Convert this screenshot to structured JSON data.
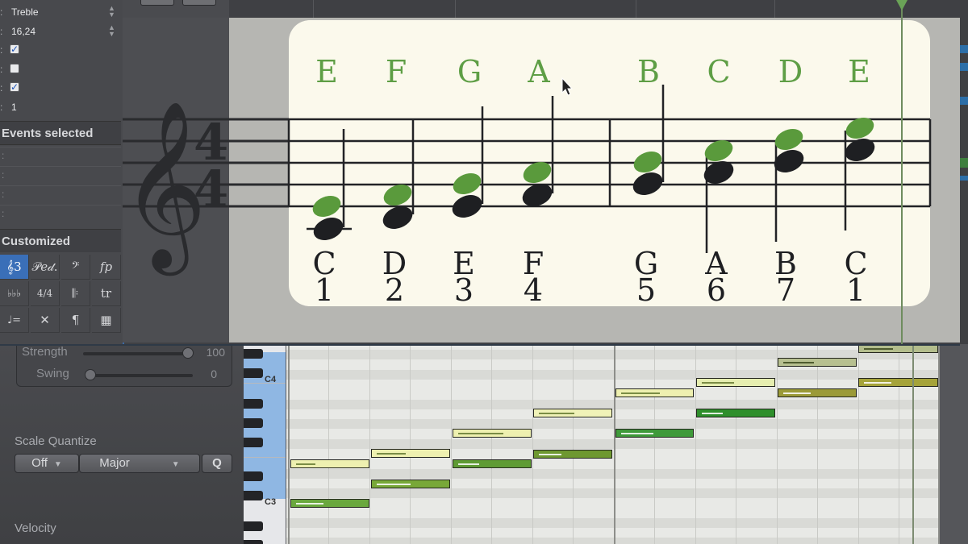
{
  "inspector": {
    "clef_value": "Treble",
    "position_value": "16,24",
    "checkbox_1_checked": true,
    "checkbox_2_checked": false,
    "checkbox_3_checked": true,
    "channel_value": "1",
    "events_selected_label": "Events selected",
    "event_colon": ":",
    "customized_label": "Customized",
    "palette_symbols": [
      "𝄞3",
      "𝒫𝑒𝒹.",
      "𝄢",
      "fp",
      "♭♭♭",
      "4/4",
      "𝄆",
      "tr",
      "♩=",
      "✕",
      "¶",
      "▦"
    ]
  },
  "score": {
    "time_sig_top": "4",
    "time_sig_bottom": "4",
    "scale_letters": [
      "E",
      "F",
      "G",
      "A",
      "B",
      "C",
      "D",
      "E"
    ],
    "note_letters": [
      "C",
      "D",
      "E",
      "F",
      "G",
      "A",
      "B",
      "C"
    ],
    "note_numbers": [
      "1",
      "2",
      "3",
      "4",
      "5",
      "6",
      "7",
      "1"
    ]
  },
  "quantize": {
    "strength_label": "Strength",
    "strength_value": "100",
    "swing_label": "Swing",
    "swing_value": "0",
    "scale_quantize_label": "Scale Quantize",
    "mode_off": "Off",
    "mode_scale": "Major",
    "q_button": "Q",
    "velocity_label": "Velocity"
  },
  "keyboard": {
    "c4_label": "C4",
    "c3_label": "C3"
  },
  "colors": {
    "sheet_bg": "#fbf9ec",
    "green_note": "#5a9a3c",
    "black_note": "#1e1f22",
    "green_letters": "#5e9e45"
  }
}
